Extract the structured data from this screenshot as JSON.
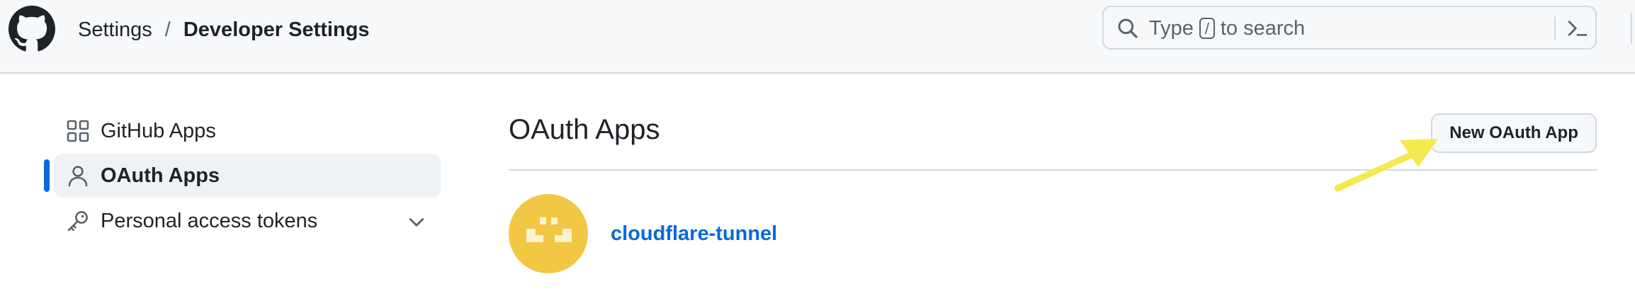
{
  "header": {
    "breadcrumb": {
      "parent": "Settings",
      "separator": "/",
      "current": "Developer Settings"
    },
    "search": {
      "prefix": "Type",
      "shortcut_key": "/",
      "suffix": "to search"
    }
  },
  "sidebar": {
    "items": [
      {
        "label": "GitHub Apps",
        "icon": "apps-grid-icon",
        "active": false
      },
      {
        "label": "OAuth Apps",
        "icon": "person-icon",
        "active": true
      },
      {
        "label": "Personal access tokens",
        "icon": "key-icon",
        "active": false,
        "expandable": true
      }
    ]
  },
  "main": {
    "title": "OAuth Apps",
    "new_button_label": "New OAuth App",
    "apps": [
      {
        "name": "cloudflare-tunnel",
        "avatar_color": "#f2c744"
      }
    ]
  },
  "colors": {
    "link": "#0969da",
    "active_indicator": "#0969da",
    "annotation_arrow": "#f5e94e",
    "header_bg": "#f6f8fa"
  }
}
